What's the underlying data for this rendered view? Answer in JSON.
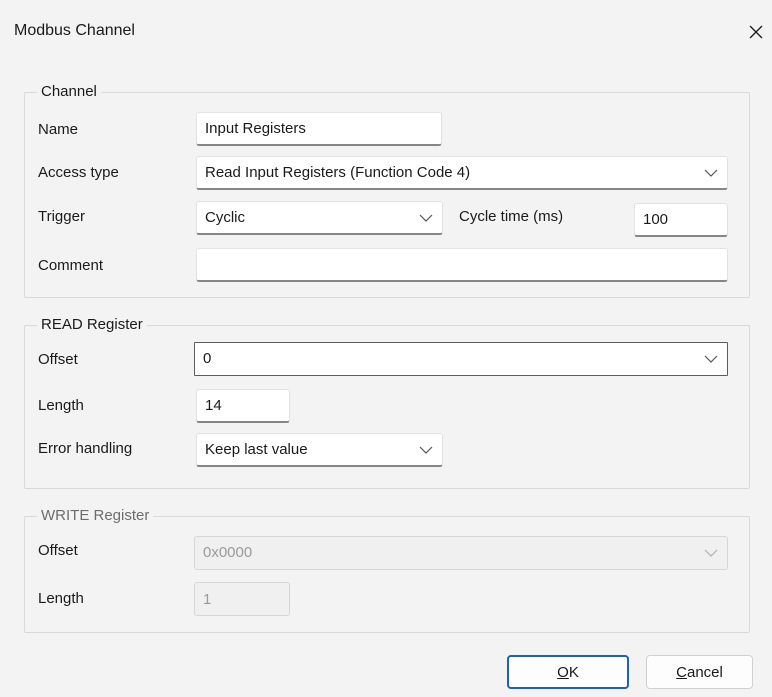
{
  "window": {
    "title": "Modbus Channel",
    "close_glyph": "×"
  },
  "channel": {
    "legend": "Channel",
    "name_label": "Name",
    "name_value": "Input Registers",
    "access_label": "Access type",
    "access_value": "Read Input Registers (Function Code 4)",
    "trigger_label": "Trigger",
    "trigger_value": "Cyclic",
    "cycle_label": "Cycle time (ms)",
    "cycle_value": "100",
    "comment_label": "Comment",
    "comment_value": ""
  },
  "read": {
    "legend": "READ Register",
    "offset_label": "Offset",
    "offset_value": "0",
    "length_label": "Length",
    "length_value": "14",
    "error_label": "Error handling",
    "error_value": "Keep last value"
  },
  "write": {
    "legend": "WRITE Register",
    "offset_label": "Offset",
    "offset_value": "0x0000",
    "length_label": "Length",
    "length_value": "1"
  },
  "buttons": {
    "ok_mnemonic": "O",
    "ok_rest": "K",
    "cancel_mnemonic": "C",
    "cancel_rest": "ancel"
  },
  "colors": {
    "accent": "#1f5fb8",
    "background": "#f3f3f3",
    "border": "#d9d9d9"
  },
  "icons": {
    "close": "close-icon",
    "dropdown": "chevron-down-icon"
  }
}
